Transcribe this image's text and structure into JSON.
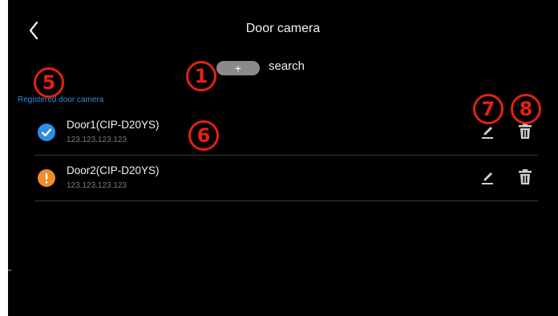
{
  "header": {
    "title": "Door camera",
    "back_icon": "chevron-left-icon"
  },
  "search": {
    "button_symbol": "+",
    "label": "search"
  },
  "section": {
    "label": "Registered door camera"
  },
  "devices": [
    {
      "name": "Door1(CIP-D20YS)",
      "ip": "123.123.123.123",
      "status": "connected",
      "status_icon": "check-circle-icon",
      "status_color": "#2d8fe2"
    },
    {
      "name": "Door2(CIP-D20YS)",
      "ip": "123.123.123.123",
      "status": "warning",
      "status_icon": "exclamation-circle-icon",
      "status_color": "#f08c2a"
    }
  ],
  "annotations": [
    "1",
    "5",
    "6",
    "7",
    "8"
  ],
  "colors": {
    "background": "#000000",
    "accent": "#2e8fd8",
    "annotation": "#e32212"
  }
}
